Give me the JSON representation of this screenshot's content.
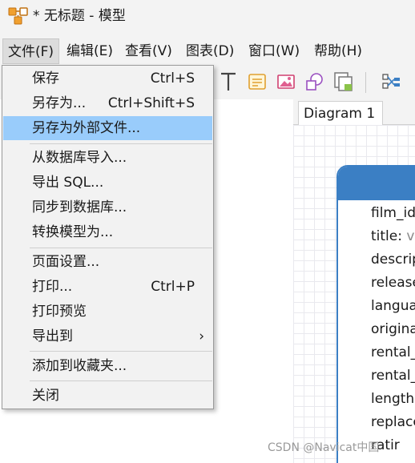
{
  "window": {
    "title": "* 无标题 - 模型",
    "app_icon": "navicat-model-icon"
  },
  "menubar": [
    {
      "label": "文件(F)"
    },
    {
      "label": "编辑(E)"
    },
    {
      "label": "查看(V)"
    },
    {
      "label": "图表(D)"
    },
    {
      "label": "窗口(W)"
    },
    {
      "label": "帮助(H)"
    }
  ],
  "toolbar": {
    "icons": [
      "text-tool-icon",
      "note-icon",
      "image-icon",
      "shape-icon",
      "layer-icon",
      "relation-icon"
    ]
  },
  "file_menu": {
    "items": [
      {
        "label": "保存",
        "shortcut": "Ctrl+S"
      },
      {
        "label": "另存为...",
        "shortcut": "Ctrl+Shift+S"
      },
      {
        "label": "另存为外部文件...",
        "shortcut": ""
      },
      {
        "label": "从数据库导入...",
        "shortcut": ""
      },
      {
        "label": "导出 SQL...",
        "shortcut": ""
      },
      {
        "label": "同步到数据库...",
        "shortcut": ""
      },
      {
        "label": "转换模型为...",
        "shortcut": ""
      },
      {
        "label": "页面设置...",
        "shortcut": ""
      },
      {
        "label": "打印...",
        "shortcut": "Ctrl+P"
      },
      {
        "label": "打印预览",
        "shortcut": ""
      },
      {
        "label": "导出到",
        "shortcut": ""
      },
      {
        "label": "添加到收藏夹...",
        "shortcut": ""
      },
      {
        "label": "关闭",
        "shortcut": ""
      }
    ],
    "highlighted": "另存为外部文件...",
    "submenu_arrow": "›"
  },
  "diagram": {
    "tab_label": "Diagram 1",
    "entity": {
      "fields": [
        {
          "name": "film_id",
          "type": ""
        },
        {
          "name": "title:",
          "type": " va"
        },
        {
          "name": "descrip",
          "type": ""
        },
        {
          "name": "release",
          "type": ""
        },
        {
          "name": "langua",
          "type": ""
        },
        {
          "name": "origina",
          "type": ""
        },
        {
          "name": "rental_d",
          "type": ""
        },
        {
          "name": "rental_",
          "type": ""
        },
        {
          "name": "length:",
          "type": ""
        },
        {
          "name": "replace",
          "type": ""
        },
        {
          "name": "ratir",
          "type": ""
        }
      ]
    }
  },
  "watermark": "CSDN @Navicat中国"
}
